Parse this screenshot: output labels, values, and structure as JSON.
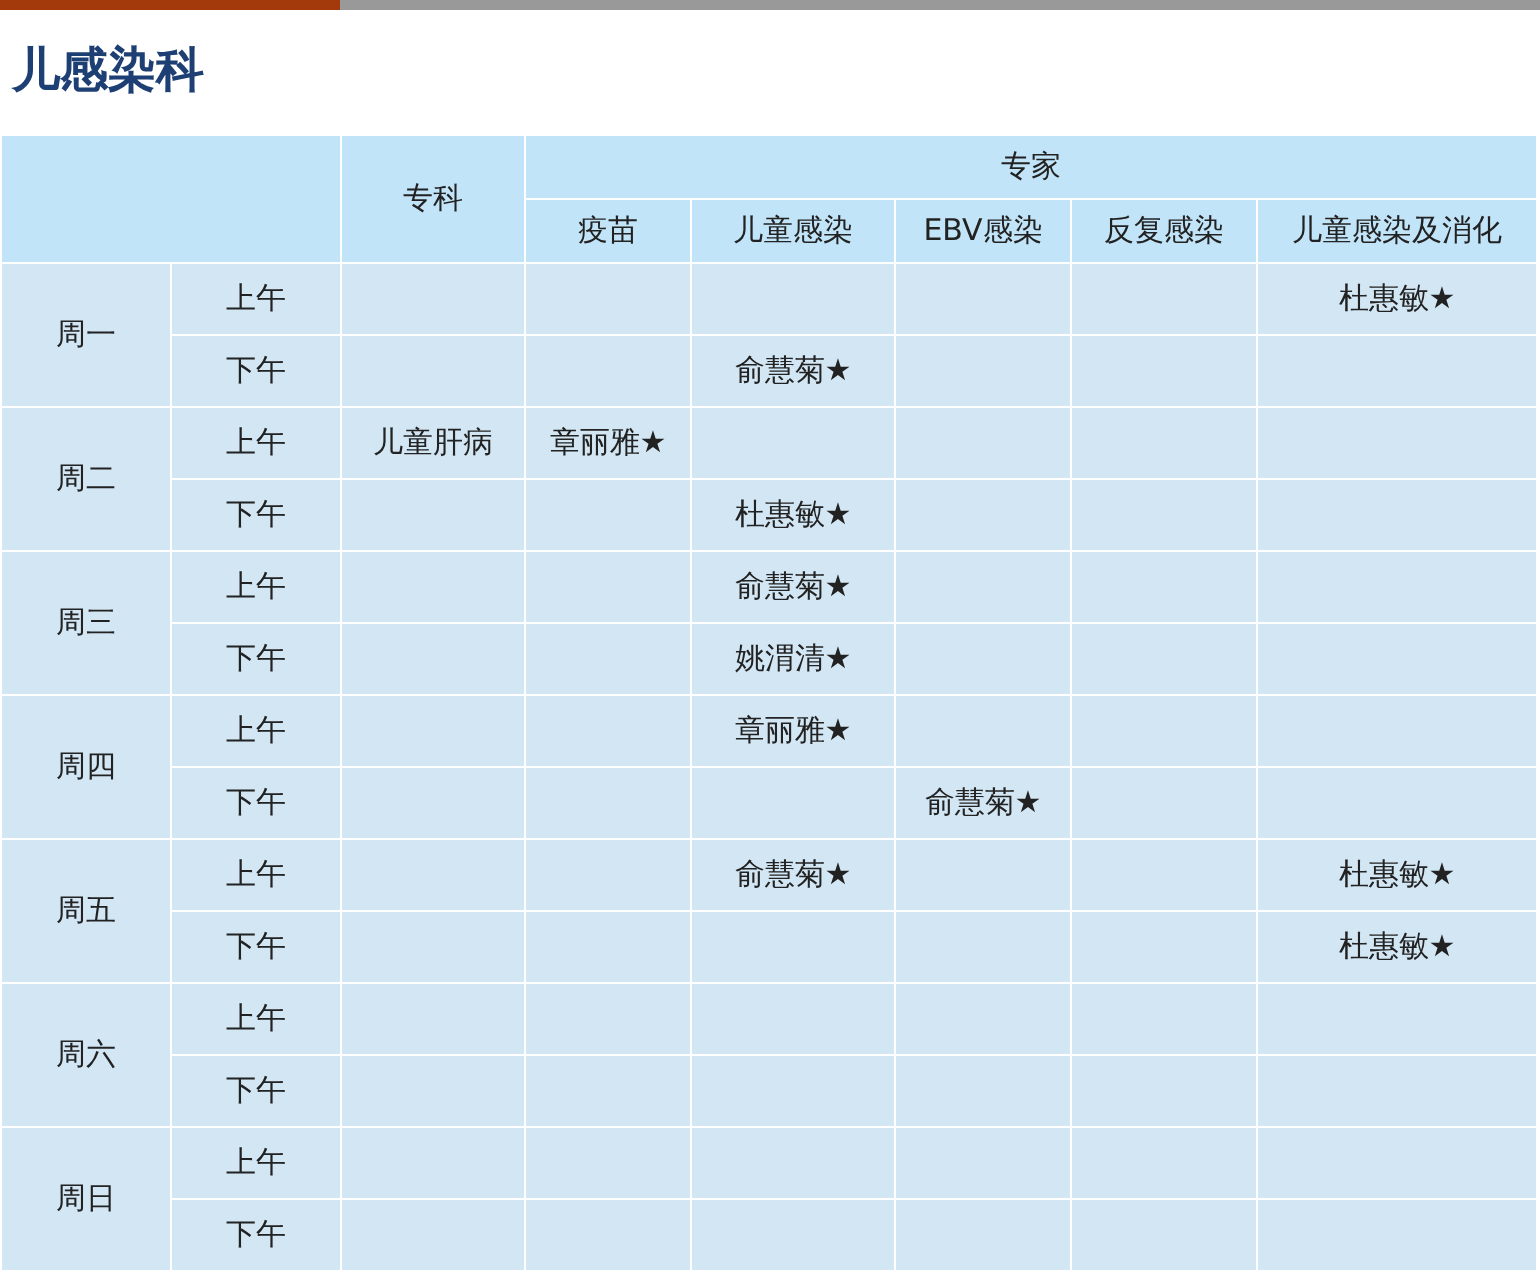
{
  "title": "儿感染科",
  "table": {
    "specialty_heading": "专科",
    "expert_heading": "专家",
    "expert_columns": [
      "疫苗",
      "儿童感染",
      "EBV感染",
      "反复感染",
      "儿童感染及消化"
    ],
    "days": [
      {
        "label": "周一",
        "periods": [
          {
            "label": "上午",
            "child_infection_digestive": "杜惠敏★"
          },
          {
            "label": "下午",
            "child_infection": "俞慧菊★"
          }
        ]
      },
      {
        "label": "周二",
        "periods": [
          {
            "label": "上午",
            "specialty": "儿童肝病",
            "vaccine": "章丽雅★"
          },
          {
            "label": "下午",
            "child_infection": "杜惠敏★"
          }
        ]
      },
      {
        "label": "周三",
        "periods": [
          {
            "label": "上午",
            "child_infection": "俞慧菊★"
          },
          {
            "label": "下午",
            "child_infection": "姚渭清★"
          }
        ]
      },
      {
        "label": "周四",
        "periods": [
          {
            "label": "上午",
            "child_infection": "章丽雅★"
          },
          {
            "label": "下午",
            "ebv": "俞慧菊★"
          }
        ]
      },
      {
        "label": "周五",
        "periods": [
          {
            "label": "上午",
            "child_infection": "俞慧菊★",
            "child_infection_digestive": "杜惠敏★"
          },
          {
            "label": "下午",
            "child_infection_digestive": "杜惠敏★"
          }
        ]
      },
      {
        "label": "周六",
        "periods": [
          {
            "label": "上午"
          },
          {
            "label": "下午"
          }
        ]
      },
      {
        "label": "周日",
        "periods": [
          {
            "label": "上午"
          },
          {
            "label": "下午"
          }
        ]
      }
    ]
  }
}
